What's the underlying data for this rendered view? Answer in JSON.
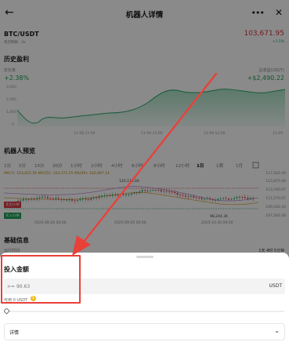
{
  "header": {
    "title": "机器人详情",
    "back": "←",
    "more": "•••",
    "close": "✕"
  },
  "pair": {
    "name": "BTC/USDT",
    "sub": "现货网格 · 3x",
    "price": "103,671.95",
    "change": "+1.5%"
  },
  "history": {
    "title": "历史盈利",
    "left_label": "年化率",
    "left_value": "+2.38%",
    "right_label": "总收益(USDT)",
    "right_value": "+$2,490.22",
    "y_ticks": [
      "3,000",
      "2,000",
      "1,000",
      "0"
    ],
    "x_ticks": [
      "11-08 12:00",
      "11-08 12:00",
      "11-09 23:00",
      "11-09 12:00",
      "11-09"
    ]
  },
  "preview": {
    "title": "机器人预览",
    "timeframes": [
      "1分",
      "5分",
      "15分",
      "30分",
      "1小时",
      "2小时",
      "4小时",
      "6小时",
      "8小时",
      "12小时",
      "1日",
      "1周",
      "1月"
    ],
    "selected_tf": "1日",
    "ma_legend": "MA(7): 103,652.56   MA(25): 103,371.25   MA(99): 102,897.14",
    "price_right": [
      "117,562.49",
      "115,870.48",
      "113,760.07",
      "111,570.07",
      "109,542.43",
      "107,562.46",
      "105,555.81",
      "103,671.95"
    ],
    "peak_label": "120,118.00",
    "low_label": "98,244.36",
    "date_ticks": [
      "2025-08-20 00:00",
      "2025-09-25 00:00",
      "2025-10-30 00:00"
    ],
    "badge_top": "卖出价格",
    "badge_bottom": "买入价格"
  },
  "basic_info": {
    "title": "基础信息",
    "row_label": "运行时间",
    "row_value": "1天 4时 5分钟"
  },
  "sheet": {
    "title": "投入金额",
    "placeholder": ">= 90.63",
    "unit": "USDT",
    "available": "可用 0 USDT",
    "detail_label": "详情",
    "chevron": "⌄"
  },
  "colors": {
    "up": "#1aa055",
    "down": "#d9343d",
    "accent": "#f0b90b",
    "highlight": "#e8413a"
  }
}
